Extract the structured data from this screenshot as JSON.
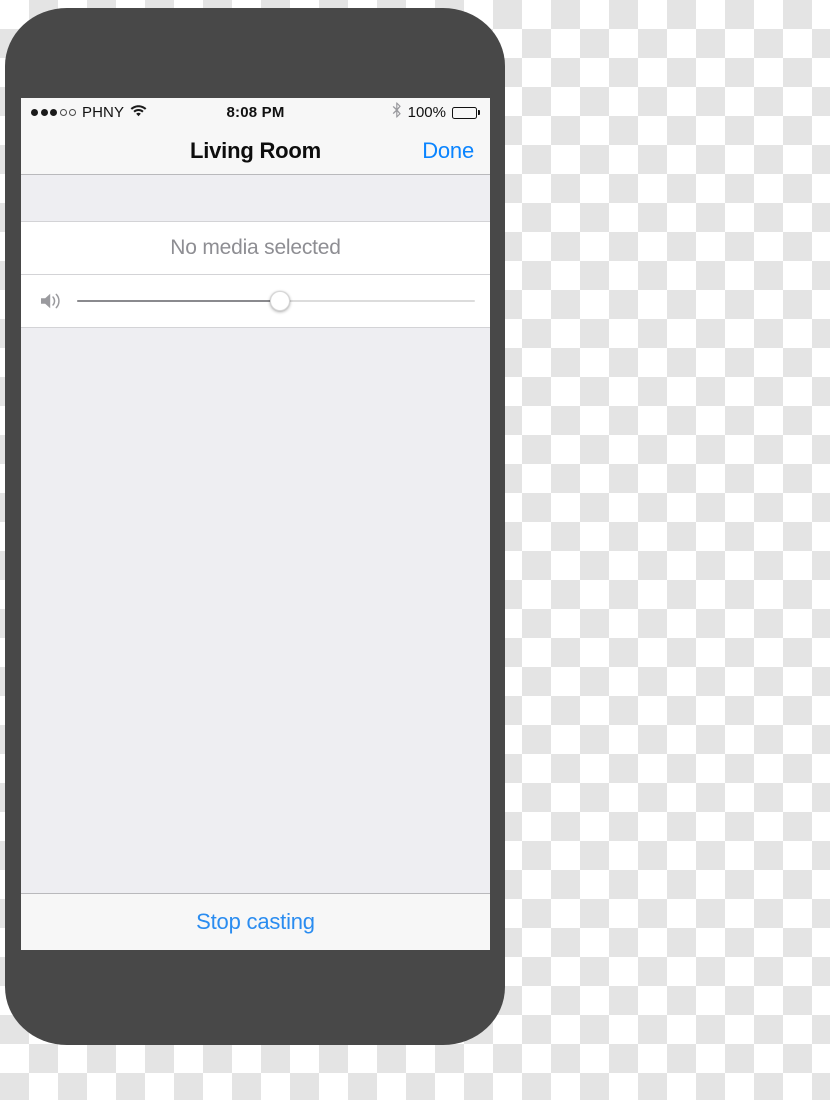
{
  "status_bar": {
    "carrier": "PHNY",
    "signal_filled": 3,
    "signal_total": 5,
    "wifi_icon": "wifi-icon",
    "time": "8:08 PM",
    "bluetooth_icon": "bluetooth-icon",
    "battery_percent": "100%",
    "battery_level": 100
  },
  "nav_bar": {
    "title": "Living Room",
    "done_label": "Done"
  },
  "media": {
    "status_text": "No media selected"
  },
  "volume": {
    "speaker_icon": "speaker-waves-icon",
    "value": 51,
    "min": 0,
    "max": 100
  },
  "footer": {
    "stop_label": "Stop casting"
  },
  "colors": {
    "accent_blue": "#0a84ff",
    "footer_blue": "#2a8cf0",
    "phone_body": "#484848",
    "screen_bg": "#eeeef2",
    "bar_bg": "#f7f7f7",
    "muted_text": "#8e8e93"
  }
}
